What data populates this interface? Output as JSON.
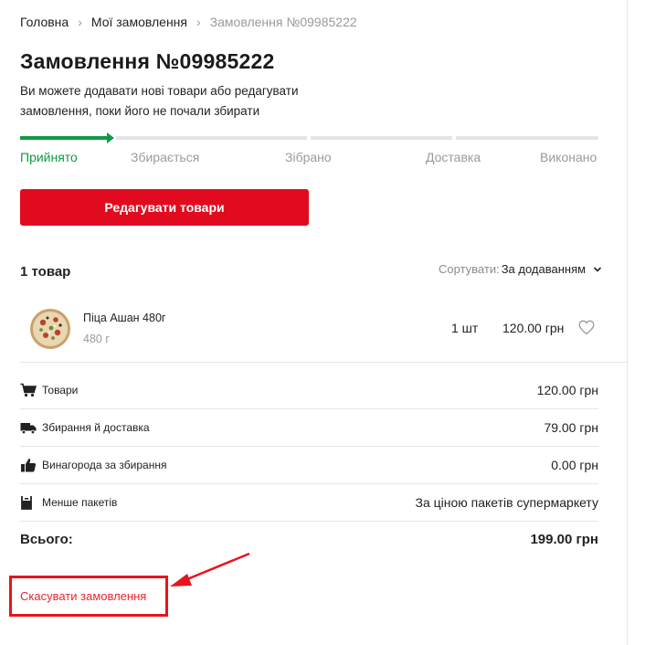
{
  "breadcrumb": [
    {
      "label": "Головна"
    },
    {
      "label": "Мої замовлення"
    },
    {
      "label": "Замовлення №09985222"
    }
  ],
  "order": {
    "title": "Замовлення №09985222",
    "description": "Ви можете додавати нові товари або редагувати замовлення, поки його не почали збирати"
  },
  "progress": {
    "completed_steps": 1,
    "steps": [
      "Прийнято",
      "Збирається",
      "Зібрано",
      "Доставка",
      "Виконано"
    ]
  },
  "edit_button_label": "Редагувати товари",
  "items_header": {
    "count_label": "1 товар",
    "sort_label": "Сортувати:",
    "sort_value": "За додаванням"
  },
  "product": {
    "name": "Піца Ашан 480г",
    "weight": "480 г",
    "quantity": "1 шт",
    "price": "120.00 грн",
    "image_icon": "pizza-image"
  },
  "summary": [
    {
      "icon": "cart-icon",
      "label": "Товари",
      "value": "120.00 грн"
    },
    {
      "icon": "truck-icon",
      "label": "Збирання й доставка",
      "value": "79.00 грн"
    },
    {
      "icon": "thumbs-up-icon",
      "label": "Винагорода за збирання",
      "value": "0.00 грн"
    },
    {
      "icon": "bag-icon",
      "label": "Менше пакетів",
      "value": "За ціною пакетів супермаркету"
    }
  ],
  "total": {
    "label": "Всього:",
    "value": "199.00 грн"
  },
  "cancel_link": "Скасувати замовлення",
  "colors": {
    "accent_red": "#e20a1f",
    "progress_green": "#0e9b43",
    "annotation_red": "#e8141c"
  }
}
